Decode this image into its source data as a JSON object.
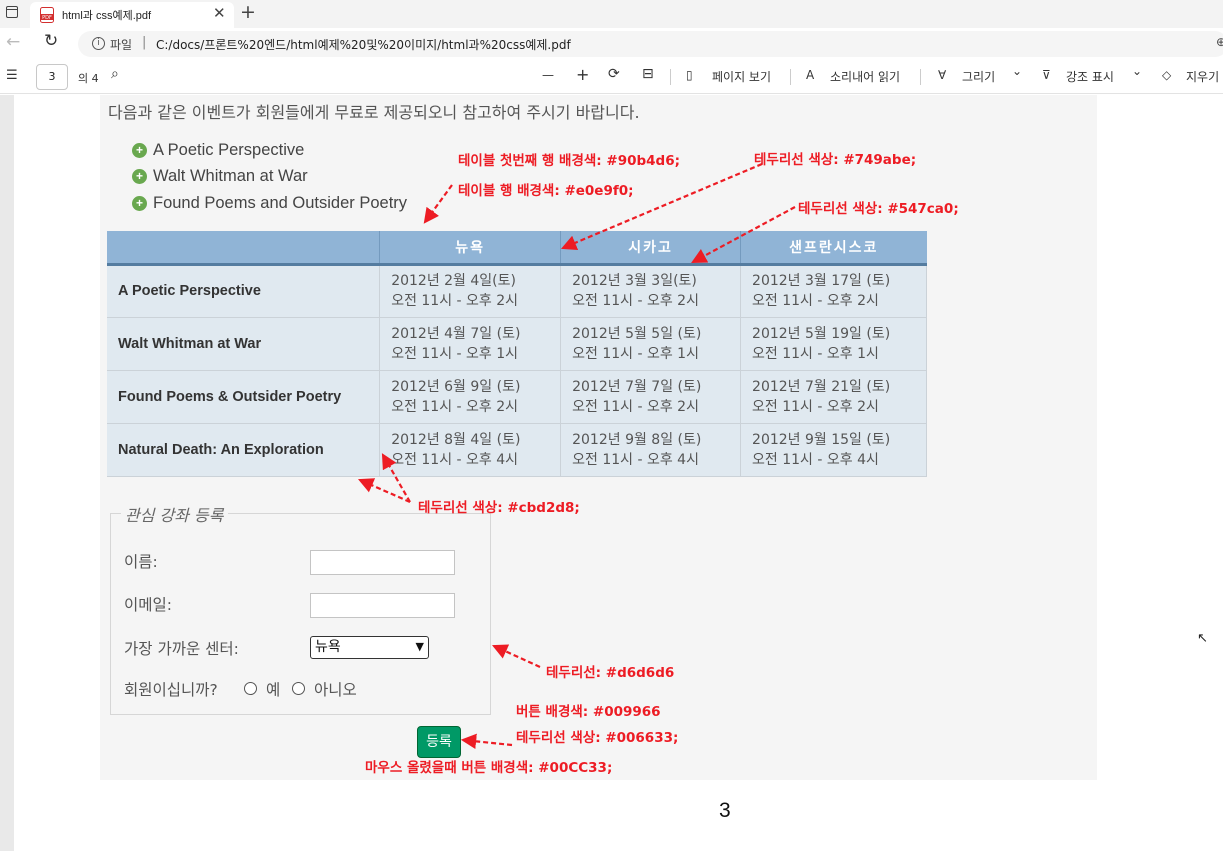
{
  "browser": {
    "tab_title": "html과 css예제.pdf",
    "tab_close": "✕",
    "new_tab": "+",
    "url_label": "파일",
    "url_sep": "|",
    "url": "C:/docs/프론트%20엔드/html예제%20및%20이미지/html과%20css예제.pdf",
    "url_right": "⊕"
  },
  "pdf_toolbar": {
    "page_current": "3",
    "page_of": "의 4",
    "zoom_out": "—",
    "zoom_in": "+",
    "rotate": "⟳",
    "fit": "⊟",
    "page_view": "페이지 보기",
    "read_aloud": "소리내어 읽기",
    "draw": "그리기",
    "highlight": "강조 표시",
    "erase": "지우기",
    "chevron": "⌄"
  },
  "page": {
    "intro": "다음과 같은 이벤트가 회원들에게 무료로 제공되오니 참고하여 주시기 바랍니다.",
    "events": [
      "A Poetic Perspective",
      "Walt Whitman at War",
      "Found Poems and Outsider Poetry"
    ],
    "table": {
      "headers": [
        "",
        "뉴욕",
        "시카고",
        "샌프란시스코"
      ],
      "rows": [
        {
          "title": "A Poetic Perspective",
          "cells": [
            [
              "2012년 2월 4일(토)",
              "오전 11시 - 오후 2시"
            ],
            [
              "2012년 3월 3일(토)",
              "오전 11시 - 오후 2시"
            ],
            [
              "2012년 3월 17일 (토)",
              "오전 11시 - 오후 2시"
            ]
          ]
        },
        {
          "title": "Walt Whitman at War",
          "cells": [
            [
              "2012년 4월 7일 (토)",
              "오전 11시 - 오후 1시"
            ],
            [
              "2012년 5월 5일 (토)",
              "오전 11시 - 오후 1시"
            ],
            [
              "2012년 5월 19일 (토)",
              "오전 11시 - 오후 1시"
            ]
          ]
        },
        {
          "title": "Found Poems & Outsider Poetry",
          "cells": [
            [
              "2012년 6월 9일 (토)",
              "오전 11시 - 오후 2시"
            ],
            [
              "2012년 7월 7일 (토)",
              "오전 11시 - 오후 2시"
            ],
            [
              "2012년 7월 21일 (토)",
              "오전 11시 - 오후 2시"
            ]
          ]
        },
        {
          "title": "Natural Death: An Exploration",
          "cells": [
            [
              "2012년 8월 4일 (토)",
              "오전 11시 - 오후 4시"
            ],
            [
              "2012년 9월 8일 (토)",
              "오전 11시 - 오후 4시"
            ],
            [
              "2012년 9월 15일 (토)",
              "오전 11시 - 오후 4시"
            ]
          ]
        }
      ]
    },
    "form": {
      "legend": "관심 강좌 등록",
      "name_label": "이름:",
      "email_label": "이메일:",
      "center_label": "가장 가까운 센터:",
      "center_selected": "뉴욕",
      "member_label": "회원이십니까?",
      "yes": "예",
      "no": "아니오",
      "submit": "등록"
    },
    "annotations": {
      "first_row_bg": "테이블 첫번째 행 배경색: #90b4d6;",
      "row_bg": "테이블 행 배경색: #e0e9f0;",
      "border_749abe": "테두리선 색상: #749abe;",
      "border_547ca0": "테두리선 색상: #547ca0;",
      "border_cbd2d8": "테두리선 색상: #cbd2d8;",
      "border_d6d6d6": "테두리선: #d6d6d6",
      "btn_bg": "버튼 배경색: #009966",
      "btn_border": "테두리선 색상: #006633;",
      "btn_hover": "마우스 올렸을때 버튼 배경색: #00CC33;"
    },
    "page_number": "3"
  }
}
